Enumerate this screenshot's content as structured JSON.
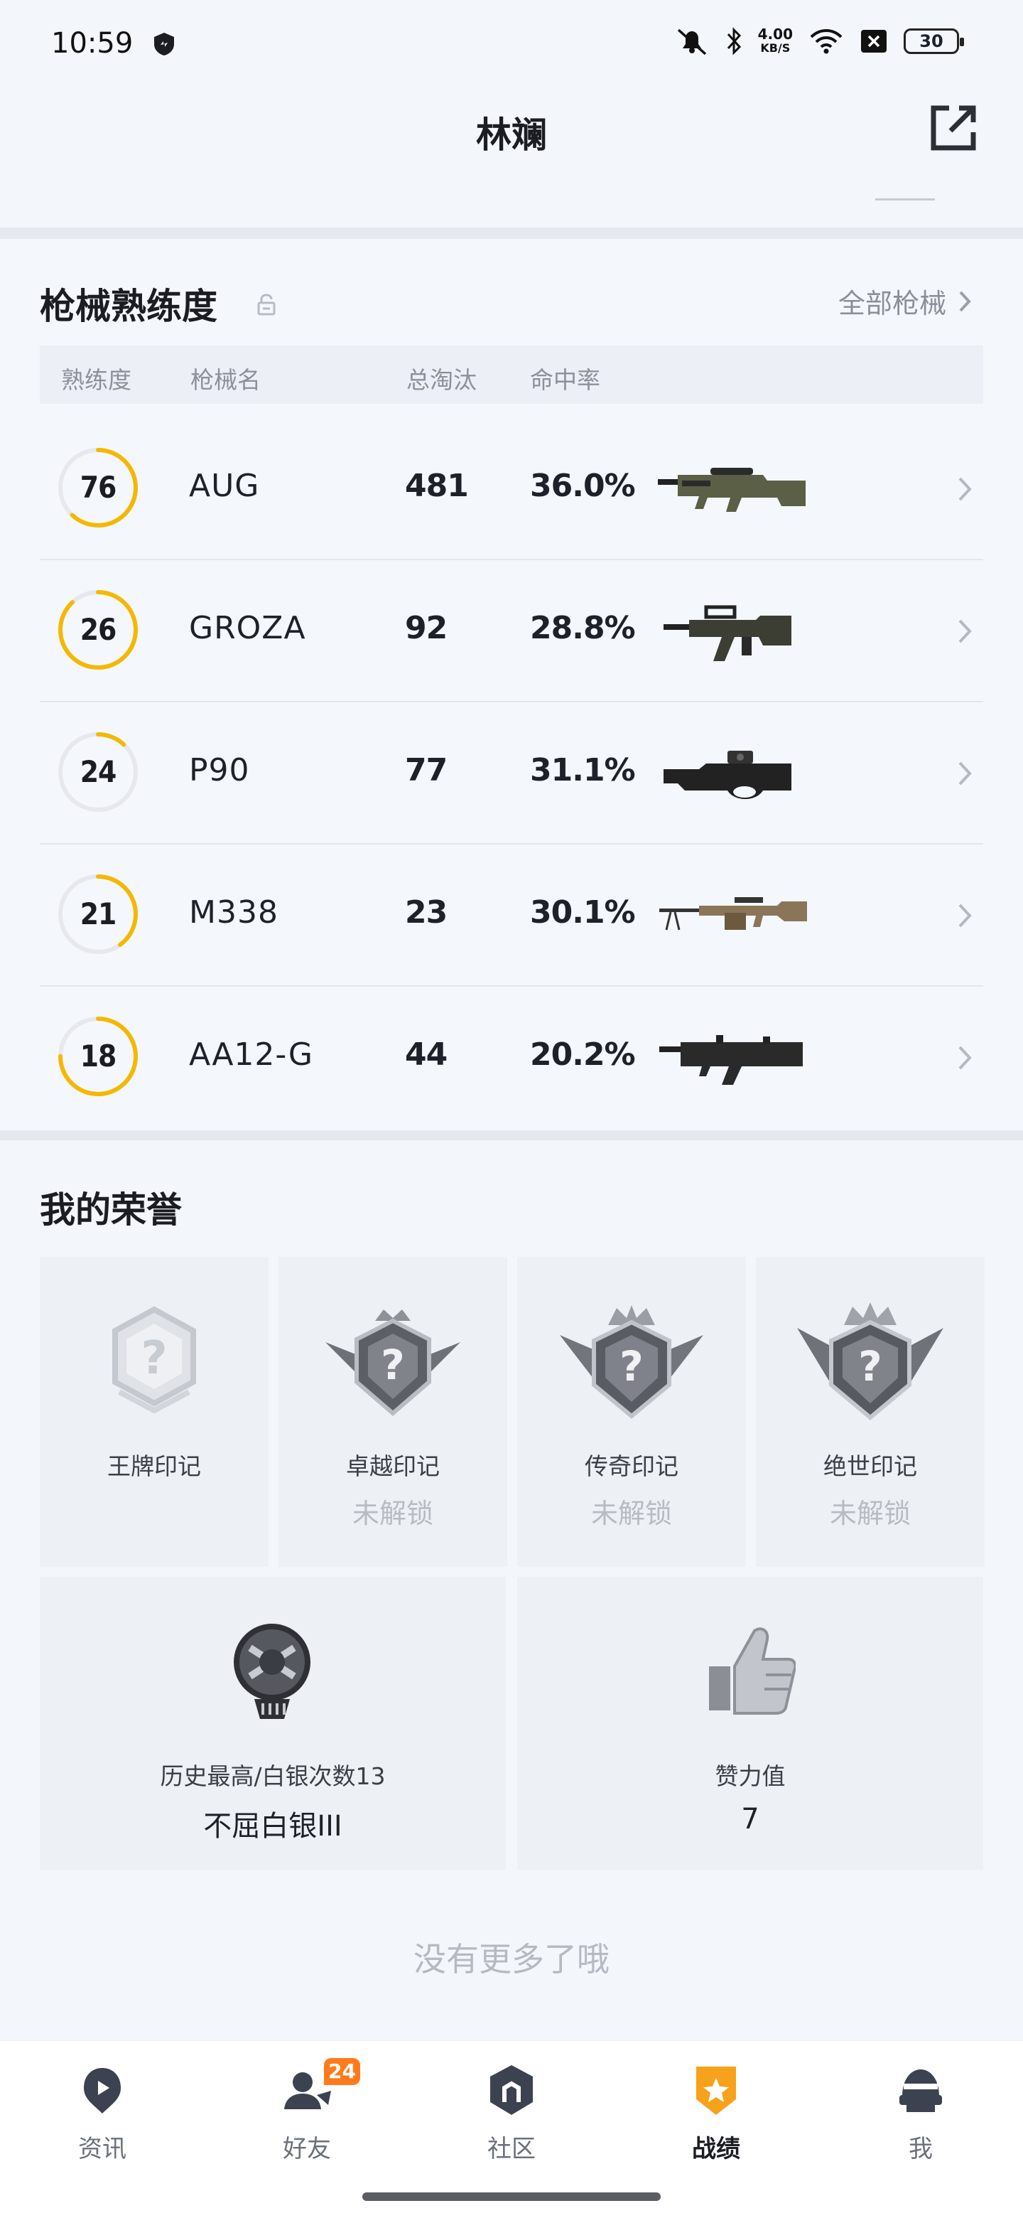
{
  "status_bar": {
    "time": "10:59",
    "speed_value": "4.00",
    "speed_unit": "KB/S",
    "battery": "30",
    "icons": [
      "shield-icon",
      "mute-icon",
      "bluetooth-icon",
      "wifi-icon",
      "sim-off-icon",
      "battery-icon"
    ]
  },
  "header": {
    "title": "林斓",
    "share_icon": "share-icon"
  },
  "weapons": {
    "title": "枪械熟练度",
    "all_label": "全部枪械",
    "columns": [
      "熟练度",
      "枪械名",
      "总淘汰",
      "命中率"
    ],
    "accent": "#f5b800",
    "rows": [
      {
        "level": "76",
        "progress": 0.62,
        "name": "AUG",
        "kills": "481",
        "hit_rate": "36.0%",
        "image": "aug-rifle-image"
      },
      {
        "level": "26",
        "progress": 0.88,
        "name": "GROZA",
        "kills": "92",
        "hit_rate": "28.8%",
        "image": "groza-rifle-image"
      },
      {
        "level": "24",
        "progress": 0.12,
        "name": "P90",
        "kills": "77",
        "hit_rate": "31.1%",
        "image": "p90-smg-image"
      },
      {
        "level": "21",
        "progress": 0.4,
        "name": "M338",
        "kills": "23",
        "hit_rate": "30.1%",
        "image": "m338-mg-image"
      },
      {
        "level": "18",
        "progress": 0.75,
        "name": "AA12-G",
        "kills": "44",
        "hit_rate": "20.2%",
        "image": "aa12-shotgun-image"
      }
    ]
  },
  "honor": {
    "title": "我的荣誉",
    "badges": [
      {
        "name": "王牌印记",
        "status": ""
      },
      {
        "name": "卓越印记",
        "status": "未解锁"
      },
      {
        "name": "传奇印记",
        "status": "未解锁"
      },
      {
        "name": "绝世印记",
        "status": "未解锁"
      }
    ],
    "rank": {
      "label": "历史最高/白银次数13",
      "value": "不屈白银III"
    },
    "likes": {
      "label": "赞力值",
      "value": "7"
    },
    "no_more": "没有更多了哦"
  },
  "nav": {
    "items": [
      {
        "label": "资讯",
        "icon": "news-icon"
      },
      {
        "label": "好友",
        "icon": "friends-icon",
        "badge": "24"
      },
      {
        "label": "社区",
        "icon": "community-icon"
      },
      {
        "label": "战绩",
        "icon": "record-icon",
        "active": true
      },
      {
        "label": "我",
        "icon": "me-icon"
      }
    ]
  }
}
